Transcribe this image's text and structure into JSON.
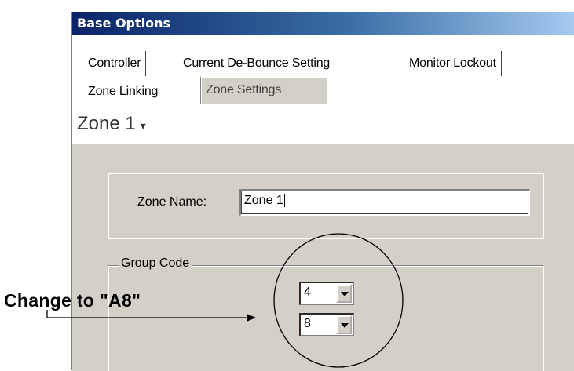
{
  "window": {
    "title": "Base Options"
  },
  "tabs": {
    "row1": [
      "Controller",
      "Current De-Bounce Setting",
      "Monitor Lockout"
    ],
    "row2": [
      "Zone Linking",
      "Zone Settings"
    ],
    "active": "Zone Settings"
  },
  "zone_selector": {
    "label": "Zone 1",
    "icon": "dropdown-caret-icon"
  },
  "form": {
    "zone_name_label": "Zone Name:",
    "zone_name_value": "Zone 1",
    "group_code_legend": "Group Code",
    "group_code_first": "4",
    "group_code_second": "8"
  },
  "annotation": {
    "text": "Change to \"A8\""
  },
  "colors": {
    "window_bg": "#d4d0c8",
    "title_start": "#0a246a",
    "title_end": "#a6caf0"
  }
}
